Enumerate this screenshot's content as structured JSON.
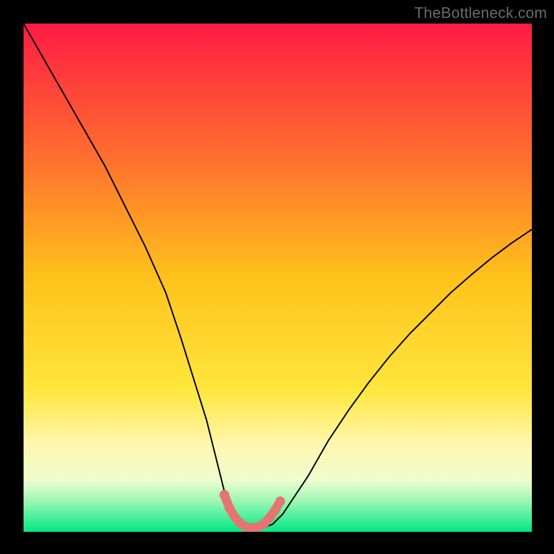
{
  "watermark": {
    "text": "TheBottleneck.com"
  },
  "chart_data": {
    "type": "line",
    "title": "",
    "xlabel": "",
    "ylabel": "",
    "xlim": [
      0,
      100
    ],
    "ylim": [
      0,
      100
    ],
    "grid": false,
    "legend": false,
    "background_gradient": {
      "stops": [
        {
          "offset": 0.0,
          "color": "#ff1b44"
        },
        {
          "offset": 0.25,
          "color": "#ff6a2f"
        },
        {
          "offset": 0.5,
          "color": "#ffc21c"
        },
        {
          "offset": 0.72,
          "color": "#ffe63c"
        },
        {
          "offset": 0.83,
          "color": "#fff7b0"
        },
        {
          "offset": 0.9,
          "color": "#edfccf"
        },
        {
          "offset": 0.94,
          "color": "#9bf7b3"
        },
        {
          "offset": 1.0,
          "color": "#00e884"
        }
      ]
    },
    "series": [
      {
        "name": "bottleneck-curve",
        "color": "#000000",
        "width": 2,
        "x": [
          0,
          4,
          8,
          12,
          16,
          20,
          24,
          28,
          31,
          33.5,
          36,
          38,
          39.5,
          41,
          43,
          45,
          47,
          49,
          51,
          53,
          56,
          60,
          64,
          68,
          72,
          76,
          80,
          84,
          88,
          92,
          96,
          100
        ],
        "y": [
          100,
          93,
          86,
          79,
          72,
          64,
          56,
          47,
          38,
          30,
          22,
          14,
          8,
          4,
          1.5,
          0.7,
          0.7,
          1.5,
          3.5,
          6.5,
          11,
          18,
          24,
          29.5,
          34.5,
          39,
          43,
          47,
          50.5,
          53.8,
          56.8,
          59.5
        ]
      },
      {
        "name": "valley-highlight",
        "color": "#e37673",
        "width": 13,
        "linecap": "round",
        "x": [
          39.5,
          40.5,
          41.5,
          42.5,
          43.5,
          44.5,
          45.5,
          46.5,
          47.5,
          48.5,
          49.5,
          50.5
        ],
        "y": [
          7.3,
          4.7,
          3.0,
          1.8,
          1.1,
          0.8,
          0.8,
          1.1,
          1.8,
          2.9,
          4.3,
          6.0
        ],
        "markers": {
          "shape": "circle",
          "r": 7
        }
      }
    ]
  }
}
